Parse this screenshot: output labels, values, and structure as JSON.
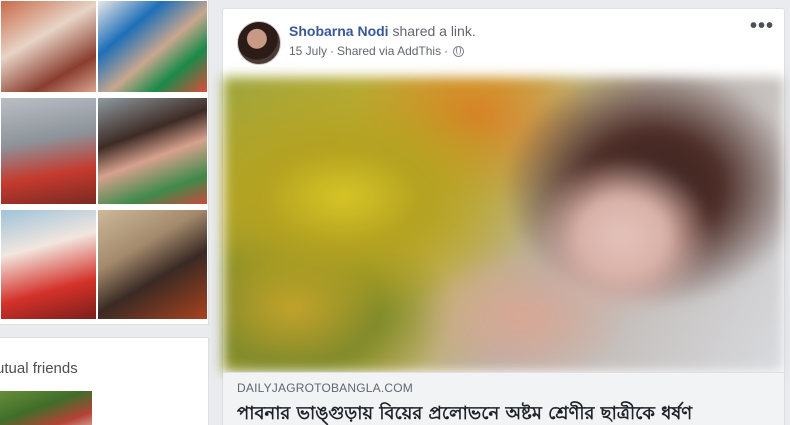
{
  "left_column": {
    "photos": [
      {
        "name": "photo-1",
        "colors": [
          "#c96a4a",
          "#e7d4c6",
          "#8a3d2e"
        ]
      },
      {
        "name": "photo-2",
        "colors": [
          "#1a8a4a",
          "#e04a3a",
          "#f2f2f2"
        ]
      },
      {
        "name": "photo-3",
        "colors": [
          "#b9bfc4",
          "#c53a2e",
          "#7a8088"
        ]
      },
      {
        "name": "photo-4",
        "colors": [
          "#8e9aa0",
          "#3d2b25",
          "#3f8a4a"
        ]
      },
      {
        "name": "photo-5",
        "colors": [
          "#9ec3d9",
          "#d4322a",
          "#f2e6df"
        ]
      },
      {
        "name": "photo-6",
        "colors": [
          "#cdb89a",
          "#3a2a24",
          "#a9421f"
        ]
      }
    ],
    "mutual_friends_label": "utual friends"
  },
  "post": {
    "author": "Shobarna Nodi",
    "action": "shared a link.",
    "date": "15 July",
    "separator": "·",
    "via": "Shared via AddThis",
    "separator2": "·",
    "audience_icon": "globe-icon",
    "more_icon": "•••",
    "link": {
      "domain": "DAILYJAGROTOBANGLA.COM",
      "title": "পাবনার ভাঙ্গুড়ায় বিয়ের প্রলোভনে অষ্টম শ্রেণীর ছাত্রীকে ধর্ষণ"
    }
  },
  "colors": {
    "page_bg": "#e9ebee",
    "card_bg": "#ffffff",
    "author_link": "#385898",
    "meta_text": "#616770",
    "link_footer_bg": "#f2f3f5"
  }
}
